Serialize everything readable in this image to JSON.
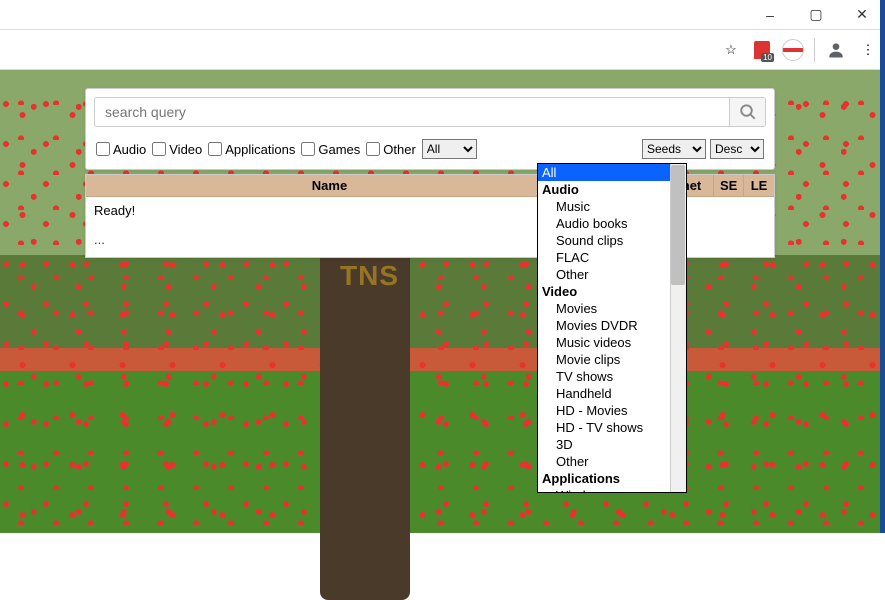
{
  "window": {
    "minimize": "–",
    "maximize": "▢",
    "close": "✕"
  },
  "toolbar": {
    "star": "☆",
    "ext_count": "10",
    "profile": "",
    "menu": "⋮"
  },
  "search": {
    "placeholder": "search query",
    "value": ""
  },
  "filters": {
    "audio": "Audio",
    "video": "Video",
    "applications": "Applications",
    "games": "Games",
    "other": "Other",
    "category_selected": "All",
    "sort_selected": "Seeds",
    "order_selected": "Desc"
  },
  "table": {
    "headers": {
      "name": "Name",
      "uploaded": "",
      "size": "",
      "magnet": "Magnet",
      "se": "SE",
      "le": "LE"
    },
    "status": "Ready!",
    "ellipsis": "..."
  },
  "dropdown": {
    "items": [
      {
        "label": "All",
        "type": "top",
        "selected": true
      },
      {
        "label": "Audio",
        "type": "group"
      },
      {
        "label": "Music",
        "type": "child"
      },
      {
        "label": "Audio books",
        "type": "child"
      },
      {
        "label": "Sound clips",
        "type": "child"
      },
      {
        "label": "FLAC",
        "type": "child"
      },
      {
        "label": "Other",
        "type": "child"
      },
      {
        "label": "Video",
        "type": "group"
      },
      {
        "label": "Movies",
        "type": "child"
      },
      {
        "label": "Movies DVDR",
        "type": "child"
      },
      {
        "label": "Music videos",
        "type": "child"
      },
      {
        "label": "Movie clips",
        "type": "child"
      },
      {
        "label": "TV shows",
        "type": "child"
      },
      {
        "label": "Handheld",
        "type": "child"
      },
      {
        "label": "HD - Movies",
        "type": "child"
      },
      {
        "label": "HD - TV shows",
        "type": "child"
      },
      {
        "label": "3D",
        "type": "child"
      },
      {
        "label": "Other",
        "type": "child"
      },
      {
        "label": "Applications",
        "type": "group"
      },
      {
        "label": "Windows",
        "type": "child"
      }
    ]
  },
  "watermark": "TNS"
}
